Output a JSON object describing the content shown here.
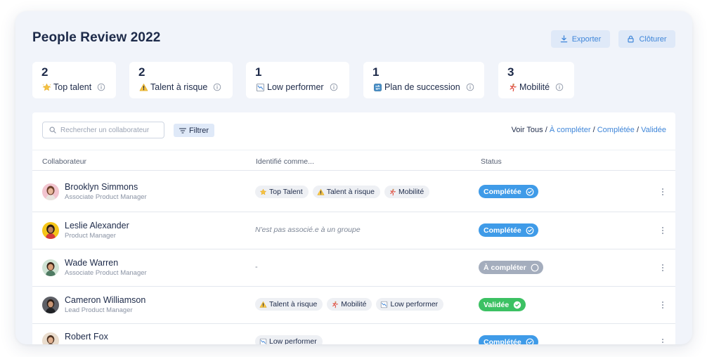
{
  "header": {
    "title": "People Review 2022",
    "export_label": "Exporter",
    "close_label": "Clôturer"
  },
  "stats": [
    {
      "count": "2",
      "label": "Top talent",
      "icon": "star-icon"
    },
    {
      "count": "2",
      "label": "Talent à risque",
      "icon": "warning-icon"
    },
    {
      "count": "1",
      "label": "Low performer",
      "icon": "chart-down-icon"
    },
    {
      "count": "1",
      "label": "Plan de succession",
      "icon": "succession-icon"
    },
    {
      "count": "3",
      "label": "Mobilité",
      "icon": "runner-icon"
    }
  ],
  "toolbar": {
    "search_placeholder": "Rechercher un collaborateur",
    "filter_label": "Filtrer",
    "view_prefix": "Voir",
    "view_all": "Tous",
    "view_todo": "À compléter",
    "view_done": "Complétée",
    "view_validated": "Validée",
    "sep": "/"
  },
  "table": {
    "columns": [
      "Collaborateur",
      "Identifié comme...",
      "Status"
    ],
    "rows": [
      {
        "name": "Brooklyn Simmons",
        "role": "Associate Product Manager",
        "tags": [
          {
            "label": "Top Talent",
            "icon": "star-icon"
          },
          {
            "label": "Talent à risque",
            "icon": "warning-icon"
          },
          {
            "label": "Mobilité",
            "icon": "runner-icon"
          }
        ],
        "status": "Complétée"
      },
      {
        "name": "Leslie Alexander",
        "role": "Product Manager",
        "no_group": "N'est pas associé.e à un groupe",
        "status": "Complétée"
      },
      {
        "name": "Wade Warren",
        "role": "Associate Product Manager",
        "dash": "-",
        "status": "À compléter"
      },
      {
        "name": "Cameron Williamson",
        "role": "Lead Product Manager",
        "tags": [
          {
            "label": "Talent à risque",
            "icon": "warning-icon"
          },
          {
            "label": "Mobilité",
            "icon": "runner-icon"
          },
          {
            "label": "Low performer",
            "icon": "chart-down-icon"
          }
        ],
        "status": "Validée"
      },
      {
        "name": "Robert Fox",
        "role": "",
        "tags": [
          {
            "label": "Low performer",
            "icon": "chart-down-icon"
          }
        ],
        "status": "Complétée"
      }
    ]
  },
  "colors": {
    "accent": "#3f86d9",
    "status_complete": "#3f9be8",
    "status_todo": "#a4adbd",
    "status_validated": "#3cc163"
  }
}
